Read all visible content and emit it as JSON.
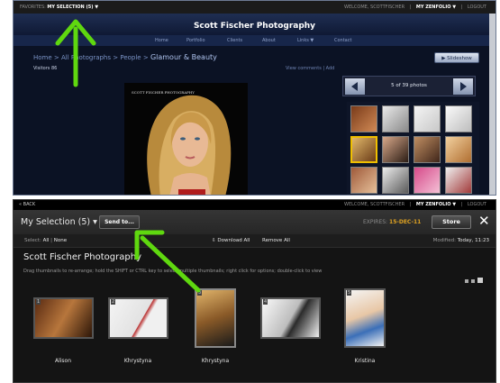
{
  "top_window": {
    "favorites_label": "FAVORITES:",
    "selection_label": "MY SELECTION (5) ▼",
    "welcome": "WELCOME, SCOTTFISCHER",
    "zenfolio": "MY ZENFOLIO ▼",
    "logout": "LOGOUT",
    "site_title": "Scott Fischer Photography",
    "nav": [
      "Home",
      "Portfolio",
      "Clients",
      "About",
      "Links ▼",
      "Contact"
    ],
    "breadcrumb": {
      "home": "Home",
      "all": "All Photographs",
      "people": "People",
      "current": "Glamour & Beauty"
    },
    "visitors": "Visitors 86",
    "view_comments": "View comments | Add",
    "slideshow": "▶ Slideshow",
    "photo_count": "5 of 39 photos",
    "main_photo_caption": "SCOTT FISCHER PHOTOGRAPHY"
  },
  "bottom_window": {
    "back": "« BACK",
    "welcome": "WELCOME, SCOTTFISCHER",
    "zenfolio": "MY ZENFOLIO ▼",
    "logout": "LOGOUT",
    "selection_title": "My Selection (5) ▾",
    "send_to": "Send to...",
    "expires_label": "EXPIRES:",
    "expires_date": "15-DEC-11",
    "store": "Store",
    "close": "✕",
    "select_label": "Select:",
    "select_all": "All",
    "select_none": "None",
    "download_all": "⇩ Download All",
    "remove_all": "Remove All",
    "modified_label": "Modified:",
    "modified_value": "Today, 11:23",
    "gallery_title": "Scott Fischer Photography",
    "hint": "Drag thumbnails to re-arrange; hold the SHIFT or CTRL key to select multiple thumbnails; right click for options; double-click to view",
    "photos": [
      {
        "num": "1",
        "name": "Alison"
      },
      {
        "num": "2",
        "name": "Khrystyna"
      },
      {
        "num": "3",
        "name": "Khrystyna"
      },
      {
        "num": "4",
        "name": ""
      },
      {
        "num": "5",
        "name": "Kristina"
      }
    ]
  },
  "colors": {
    "accent_green": "#5fd80f",
    "expires_orange": "#e0a321"
  }
}
